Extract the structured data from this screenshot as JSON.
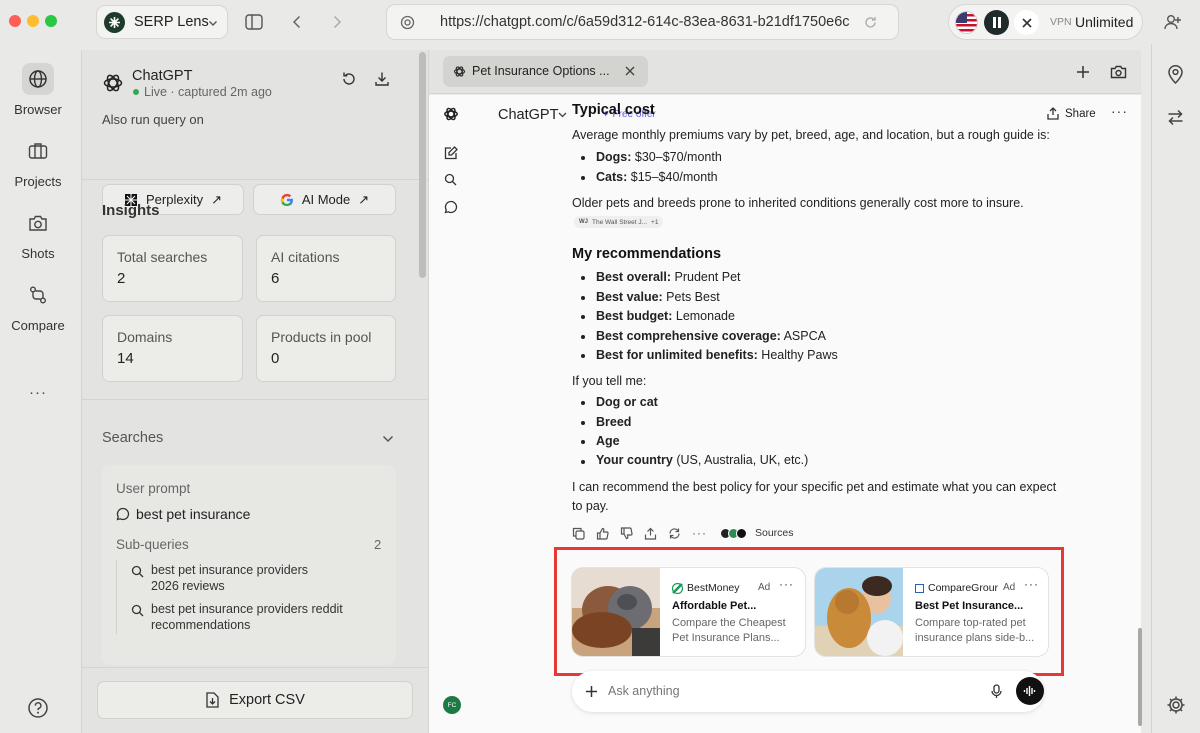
{
  "window": {
    "app_name": "SERP Lens",
    "url": "https://chatgpt.com/c/6a59d312-614c-83ea-8631-b21df1750e6c",
    "vpn_label": "VPN",
    "vpn_status": "Unlimited"
  },
  "rail": {
    "items": [
      {
        "label": "Browser",
        "icon": "globe-icon"
      },
      {
        "label": "Projects",
        "icon": "briefcase-icon"
      },
      {
        "label": "Shots",
        "icon": "camera-icon"
      },
      {
        "label": "Compare",
        "icon": "compare-icon"
      }
    ],
    "more": "···"
  },
  "panel": {
    "engine_name": "ChatGPT",
    "status": "Live · captured 2m ago",
    "also_run_label": "Also run query on",
    "perplexity_label": "Perplexity",
    "aimode_label": "AI Mode",
    "insights_title": "Insights",
    "stats": [
      {
        "label": "Total searches",
        "value": "2"
      },
      {
        "label": "AI citations",
        "value": "6"
      },
      {
        "label": "Domains",
        "value": "14"
      },
      {
        "label": "Products in pool",
        "value": "0"
      }
    ],
    "searches_title": "Searches",
    "user_prompt_label": "User prompt",
    "user_prompt": "best pet insurance",
    "subqueries_label": "Sub-queries",
    "subqueries_count": "2",
    "subqueries": [
      {
        "line1": "best pet insurance providers",
        "line2": "2026 reviews"
      },
      {
        "line1": "best pet insurance providers reddit",
        "line2": "recommendations"
      }
    ],
    "export_label": "Export CSV"
  },
  "tab": {
    "title": "Pet Insurance Options ..."
  },
  "chat": {
    "model_label": "ChatGPT",
    "free_offer": "Free offer",
    "share_label": "Share",
    "typical_cost_heading": "Typical cost",
    "cost_intro": "Average monthly premiums vary by pet, breed, age, and location, but a rough guide is:",
    "cost_items": [
      {
        "bold": "Dogs:",
        "text": " $30–$70/month"
      },
      {
        "bold": "Cats:",
        "text": " $15–$40/month"
      }
    ],
    "older_pets": "Older pets and breeds prone to inherited conditions generally cost more to insure.",
    "source_chip": "The Wall Street J...",
    "source_more": "+1",
    "rec_heading": "My recommendations",
    "rec_items": [
      {
        "bold": "Best overall:",
        "text": " Prudent Pet"
      },
      {
        "bold": "Best value:",
        "text": " Pets Best"
      },
      {
        "bold": "Best budget:",
        "text": " Lemonade"
      },
      {
        "bold": "Best comprehensive coverage:",
        "text": " ASPCA"
      },
      {
        "bold": "Best for unlimited benefits:",
        "text": " Healthy Paws"
      }
    ],
    "tell_me": "If you tell me:",
    "tell_items": [
      {
        "bold": "Dog or cat",
        "text": ""
      },
      {
        "bold": "Breed",
        "text": ""
      },
      {
        "bold": "Age",
        "text": ""
      },
      {
        "bold": "Your country",
        "text": " (US, Australia, UK, etc.)"
      }
    ],
    "closing_line1": "I can recommend the best policy for your specific pet and estimate what you can expect",
    "closing_line2": "to pay.",
    "sources_label": "Sources",
    "input_placeholder": "Ask anything",
    "avatar_initials": "FC"
  },
  "ads": [
    {
      "brand": "BestMoney",
      "tag": "Ad",
      "title": "Affordable Pet...",
      "desc_line1": "Compare the Cheapest",
      "desc_line2": "Pet Insurance Plans..."
    },
    {
      "brand": "CompareGrour",
      "tag": "Ad",
      "title": "Best Pet Insurance...",
      "desc_line1": "Compare top-rated pet",
      "desc_line2": "insurance plans side-b..."
    }
  ],
  "colors": {
    "highlight_border": "#e53935",
    "live_dot": "#34a853"
  }
}
